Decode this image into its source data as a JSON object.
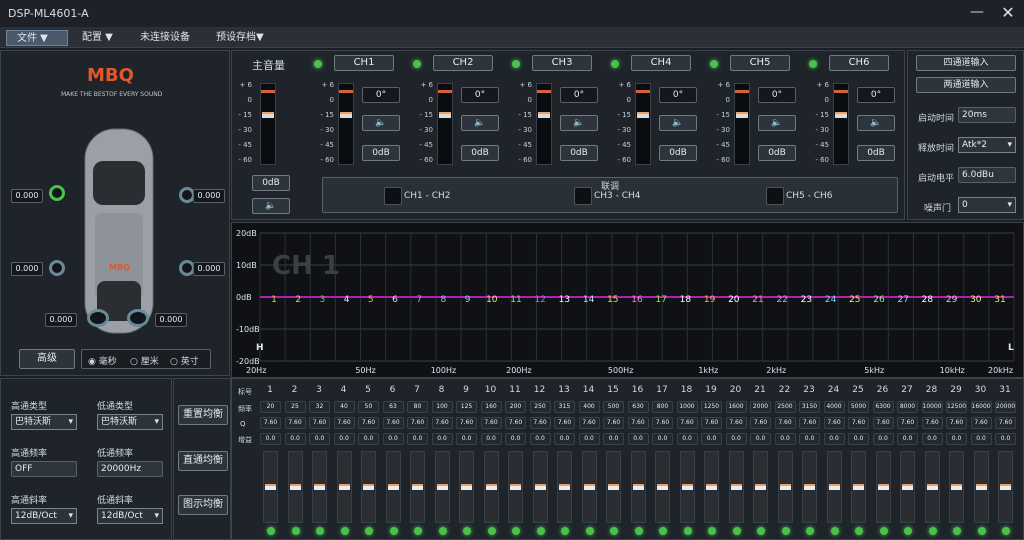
{
  "window": {
    "title": "DSP-ML4601-A",
    "minimize_icon": "minimize-icon",
    "close_icon": "close-icon"
  },
  "menu": [
    {
      "label": "文件 ▼"
    },
    {
      "label": "配置 ▼"
    },
    {
      "label": "未连接设备"
    },
    {
      "label": "预设存档▼"
    }
  ],
  "brand": {
    "logo": "MBQ",
    "tagline": "MAKE THE BESTOF EVERY SOUND",
    "car_logo": "MBQ"
  },
  "speakers": {
    "front_left": "0.000",
    "front_right": "0.000",
    "rear_left": "0.000",
    "rear_right": "0.000",
    "sub_left": "0.000",
    "sub_right": "0.000"
  },
  "advanced": {
    "label": "高级",
    "units": [
      {
        "label": "毫秒",
        "selected": true
      },
      {
        "label": "厘米",
        "selected": false
      },
      {
        "label": "英寸",
        "selected": false
      }
    ]
  },
  "master": {
    "label": "主音量",
    "gain": "0dB"
  },
  "scale_labels": [
    "+ 6",
    "0",
    "- 15",
    "- 30",
    "- 45",
    "- 60"
  ],
  "channels": [
    {
      "name": "CH1",
      "phase": "0°",
      "gain": "0dB"
    },
    {
      "name": "CH2",
      "phase": "0°",
      "gain": "0dB"
    },
    {
      "name": "CH3",
      "phase": "0°",
      "gain": "0dB"
    },
    {
      "name": "CH4",
      "phase": "0°",
      "gain": "0dB"
    },
    {
      "name": "CH5",
      "phase": "0°",
      "gain": "0dB"
    },
    {
      "name": "CH6",
      "phase": "0°",
      "gain": "0dB"
    }
  ],
  "link": {
    "title": "联调",
    "pairs": [
      "CH1 - CH2",
      "CH3 - CH4",
      "CH5 - CH6"
    ]
  },
  "input": {
    "four_channel": "四通道输入",
    "two_channel": "两通道输入"
  },
  "settings": [
    {
      "label": "启动时间",
      "value": "20ms"
    },
    {
      "label": "释放时间",
      "value": "Atk*2"
    },
    {
      "label": "启动电平",
      "value": "6.0dBu"
    },
    {
      "label": "噪声门",
      "value": "0"
    }
  ],
  "eq_graph": {
    "channel_label": "CH 1",
    "y_labels": [
      "20dB",
      "10dB",
      "0dB",
      "-10dB",
      "-20dB"
    ],
    "x_labels": [
      "20Hz",
      "50Hz",
      "100Hz",
      "200Hz",
      "500Hz",
      "1kHz",
      "2kHz",
      "5kHz",
      "10kHz",
      "20kHz"
    ],
    "h_label": "H",
    "l_label": "L",
    "band_colors": [
      "#f0c040",
      "#c0e060",
      "#60d060",
      "#e0e0ff",
      "#ffb040",
      "#e0e0e0",
      "#d080e0",
      "#b0b0ff",
      "#90c0ff",
      "#ffe070",
      "#90e090",
      "#8080ff",
      "#ffffff",
      "#c0e0ff",
      "#ffd060",
      "#e090e0",
      "#a0e060",
      "#ffffff",
      "#ffb060",
      "#ffffff",
      "#ff90c0",
      "#c0a0ff",
      "#ffffff",
      "#80d0ff",
      "#ffe080",
      "#a0e0a0",
      "#c0c0ff",
      "#ffffff",
      "#ffb0e0",
      "#ffe0a0",
      "#ffe060"
    ]
  },
  "filters": {
    "hp_type_label": "高通类型",
    "hp_type": "巴特沃斯",
    "lp_type_label": "低通类型",
    "lp_type": "巴特沃斯",
    "hp_freq_label": "高通频率",
    "hp_freq": "OFF",
    "lp_freq_label": "低通频率",
    "lp_freq": "20000Hz",
    "hp_slope_label": "高通斜率",
    "hp_slope": "12dB/Oct",
    "lp_slope_label": "低通斜率",
    "lp_slope": "12dB/Oct"
  },
  "eq_buttons": {
    "reset": "重置均衡",
    "direct": "直通均衡",
    "graphic": "图示均衡"
  },
  "eq_table": {
    "row_labels": [
      "标号",
      "频率",
      "Q",
      "增益"
    ],
    "bands": [
      {
        "n": "1",
        "f": "20"
      },
      {
        "n": "2",
        "f": "25"
      },
      {
        "n": "3",
        "f": "32"
      },
      {
        "n": "4",
        "f": "40"
      },
      {
        "n": "5",
        "f": "50"
      },
      {
        "n": "6",
        "f": "63"
      },
      {
        "n": "7",
        "f": "80"
      },
      {
        "n": "8",
        "f": "100"
      },
      {
        "n": "9",
        "f": "125"
      },
      {
        "n": "10",
        "f": "160"
      },
      {
        "n": "11",
        "f": "200"
      },
      {
        "n": "12",
        "f": "250"
      },
      {
        "n": "13",
        "f": "315"
      },
      {
        "n": "14",
        "f": "400"
      },
      {
        "n": "15",
        "f": "500"
      },
      {
        "n": "16",
        "f": "630"
      },
      {
        "n": "17",
        "f": "800"
      },
      {
        "n": "18",
        "f": "1000"
      },
      {
        "n": "19",
        "f": "1250"
      },
      {
        "n": "20",
        "f": "1600"
      },
      {
        "n": "21",
        "f": "2000"
      },
      {
        "n": "22",
        "f": "2500"
      },
      {
        "n": "23",
        "f": "3150"
      },
      {
        "n": "24",
        "f": "4000"
      },
      {
        "n": "25",
        "f": "5000"
      },
      {
        "n": "26",
        "f": "6300"
      },
      {
        "n": "27",
        "f": "8000"
      },
      {
        "n": "28",
        "f": "10000"
      },
      {
        "n": "29",
        "f": "12500"
      },
      {
        "n": "30",
        "f": "16000"
      },
      {
        "n": "31",
        "f": "20000"
      }
    ],
    "q": "7.60",
    "gain": "0.0"
  }
}
